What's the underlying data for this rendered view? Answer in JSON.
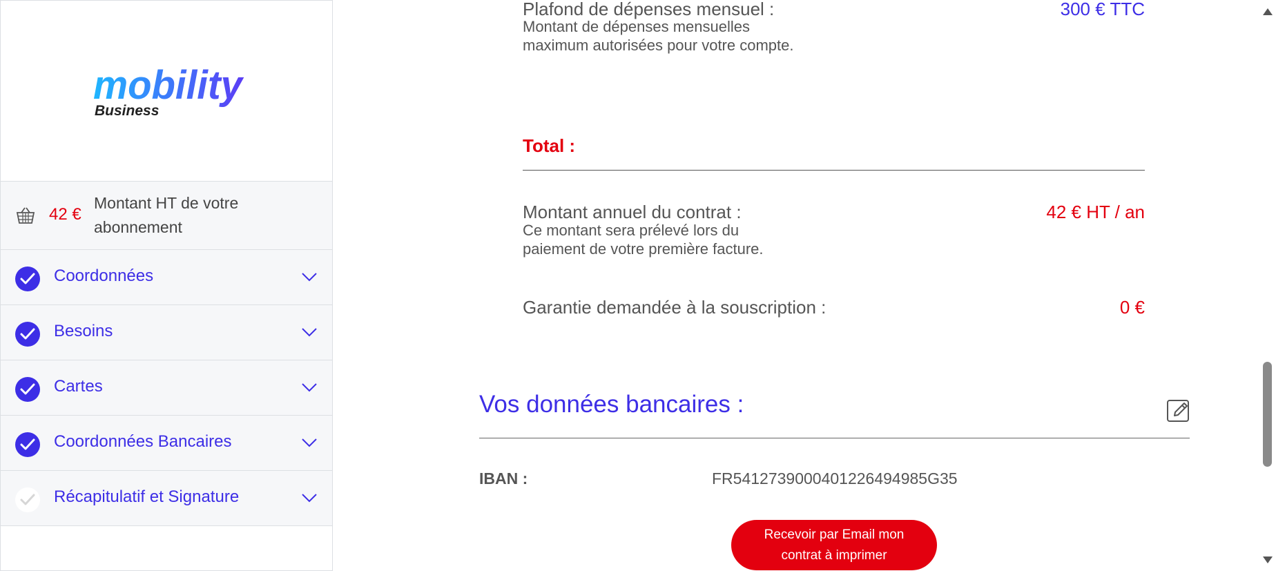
{
  "sidebar": {
    "logo": {
      "brand": "mobility",
      "sub": "Business"
    },
    "summary": {
      "amount": "42 €",
      "text": "Montant HT de votre abonnement"
    },
    "steps": [
      {
        "label": "Coordonnées",
        "done": true
      },
      {
        "label": "Besoins",
        "done": true
      },
      {
        "label": "Cartes",
        "done": true
      },
      {
        "label": "Coordonnées Bancaires",
        "done": true
      },
      {
        "label": "Récapitulatif et Signature",
        "done": false
      }
    ]
  },
  "recap": {
    "plafond": {
      "label": "Plafond de dépenses mensuel :",
      "sub": "Montant de dépenses mensuelles maximum autorisées pour votre compte.",
      "value": "300 € TTC"
    },
    "total_label": "Total :",
    "annuel": {
      "label": "Montant annuel du contrat :",
      "sub": "Ce montant sera prélevé lors du paiement de votre première facture.",
      "value": "42 € HT / an"
    },
    "garantie": {
      "label": "Garantie demandée à la souscription :",
      "value": "0 €"
    }
  },
  "bank": {
    "title": "Vos données bancaires :",
    "iban_label": "IBAN :",
    "iban_value": "FR5412739000401226494985G35"
  },
  "email_button": "Recevoir par Email mon contrat à imprimer",
  "colors": {
    "accent": "#3d2ee6",
    "danger": "#e3000f",
    "logo_gradient_start": "#1fb6ff",
    "logo_gradient_end": "#5b3df5"
  },
  "icons": {
    "basket": "basket-icon",
    "check": "check-icon",
    "chevron": "chevron-down-icon",
    "edit": "edit-icon"
  }
}
